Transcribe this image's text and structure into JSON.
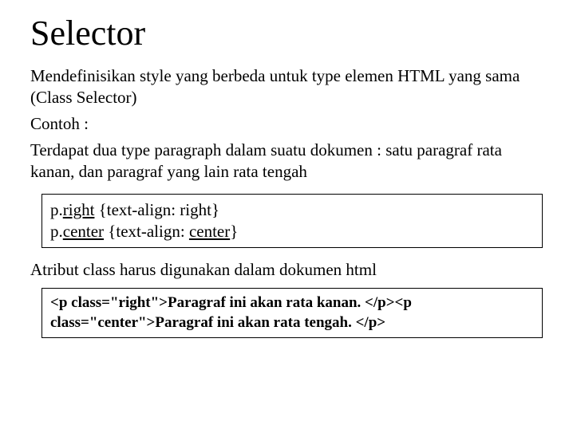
{
  "title": "Selector",
  "para1": "Mendefinisikan style yang berbeda untuk type elemen HTML yang sama (Class Selector)",
  "para2": "Contoh :",
  "para3": "Terdapat dua type paragraph dalam suatu dokumen : satu paragraf rata kanan, dan paragraf yang lain rata tengah",
  "code": {
    "l1a": "p.",
    "l1b": "right",
    "l1c": " {text-align: right}",
    "l2a": "p.",
    "l2b": "center",
    "l2c": " {text-align: ",
    "l2d": "center",
    "l2e": "}"
  },
  "para4": "Atribut class harus digunakan dalam dokumen html",
  "html": {
    "l1": "<p class=\"right\">Paragraf ini akan rata kanan. </p><p class=\"center\">Paragraf ini akan rata tengah. </p>"
  }
}
